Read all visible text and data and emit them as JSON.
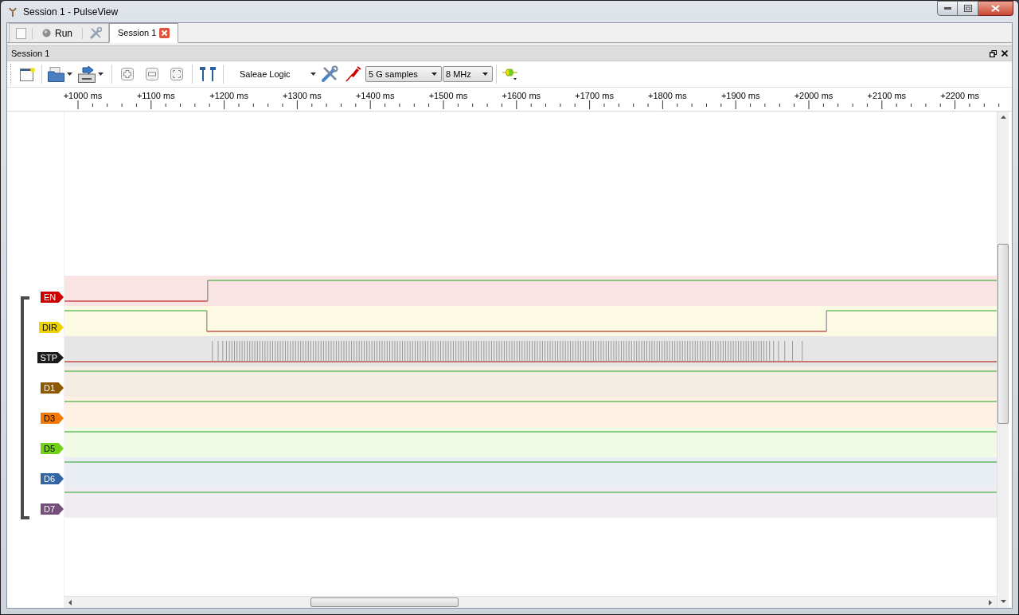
{
  "window": {
    "title": "Session 1 - PulseView"
  },
  "main_tabs": {
    "run_button": "Run",
    "tabs": [
      {
        "label": "Session 1",
        "selected": true
      }
    ]
  },
  "dock": {
    "title": "Session 1"
  },
  "toolbar": {
    "device": "Saleae Logic",
    "sample_count": "5 G samples",
    "sample_rate": "8 MHz"
  },
  "ruler": {
    "labels": [
      "+1000 ms",
      "+1100 ms",
      "+1200 ms",
      "+1300 ms",
      "+1400 ms",
      "+1500 ms",
      "+1600 ms",
      "+1700 ms",
      "+1800 ms",
      "+1900 ms",
      "+2000 ms",
      "+2100 ms",
      "+2200 ms"
    ]
  },
  "channels": [
    {
      "name": "EN",
      "color": "#cc0000",
      "kind": "rise"
    },
    {
      "name": "DIR",
      "color": "#edd400",
      "kind": "fall_rise"
    },
    {
      "name": "STP",
      "color": "#1a1a1a",
      "kind": "pulses"
    },
    {
      "name": "D1",
      "color": "#8f5902",
      "kind": "high"
    },
    {
      "name": "D3",
      "color": "#f57900",
      "kind": "high"
    },
    {
      "name": "D5",
      "color": "#73d216",
      "kind": "high"
    },
    {
      "name": "D6",
      "color": "#3465a4",
      "kind": "high"
    },
    {
      "name": "D7",
      "color": "#75507b",
      "kind": "high"
    }
  ]
}
